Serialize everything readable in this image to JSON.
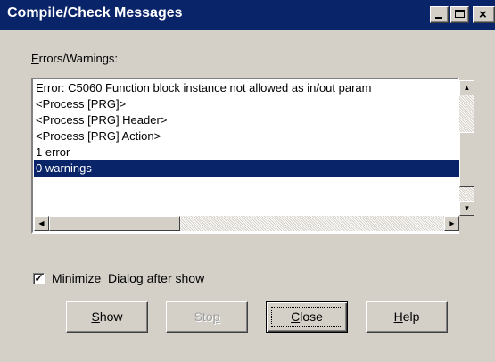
{
  "window": {
    "title": "Compile/Check Messages",
    "title_bg": "#0a246a",
    "face_color": "#d4d0c8",
    "controls": {
      "minimize": "minimize-icon",
      "maximize": "maximize-icon",
      "close": "×"
    }
  },
  "errors_label": {
    "accel": "E",
    "rest": "rrors/Warnings:"
  },
  "messages": [
    "Error: C5060 Function block instance not allowed as in/out param",
    "<Process [PRG]>",
    "<Process [PRG] Header>",
    "<Process [PRG] Action>",
    "1 error",
    "0 warnings"
  ],
  "selected_index": 5,
  "scroll_arrows": {
    "up": "▲",
    "down": "▼",
    "left": "◀",
    "right": "▶"
  },
  "minimize_option": {
    "checked": true,
    "check_glyph": "✓",
    "accel": "M",
    "rest": "inimize  Dialog after show"
  },
  "buttons": {
    "show": {
      "accel": "S",
      "rest": "how"
    },
    "stop": {
      "pre": "Sto",
      "accel": "p",
      "disabled": true
    },
    "close": {
      "accel": "C",
      "rest": "lose"
    },
    "help": {
      "accel": "H",
      "rest": "elp"
    }
  }
}
